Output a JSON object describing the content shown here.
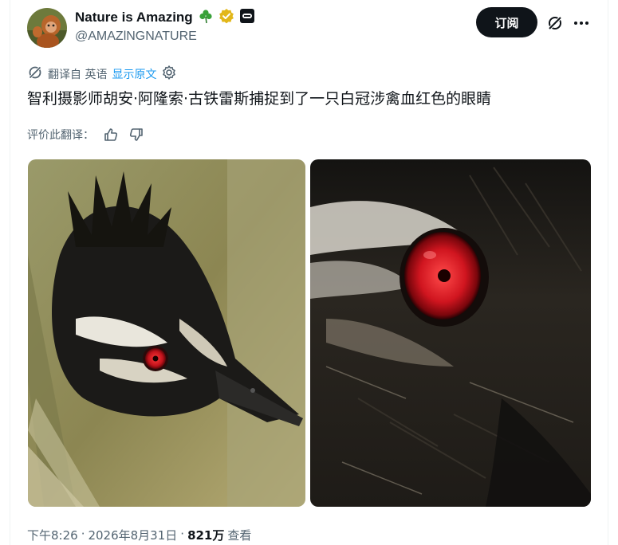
{
  "author": {
    "display_name": "Nature is Amazing",
    "emoji": "☘️",
    "handle": "@AMAZlNGNATURE"
  },
  "header": {
    "subscribe_label": "订阅"
  },
  "translation": {
    "translated_from": "翻译自 英语",
    "show_original": "显示原文"
  },
  "tweet": {
    "text": "智利摄影师胡安·阿隆索·古铁雷斯捕捉到了一只白冠涉禽血红色的眼睛"
  },
  "rating": {
    "label": "评价此翻译："
  },
  "media": [
    {
      "alt": "bird-profile-photo"
    },
    {
      "alt": "bird-eye-closeup-photo"
    }
  ],
  "meta": {
    "time": "下午8:26",
    "date": "2026年8月31日",
    "views": "821万",
    "views_label": "查看"
  },
  "colors": {
    "accent": "#1d9bf0",
    "text_primary": "#0f1419",
    "text_secondary": "#536471",
    "verified_gold": "#e2b719",
    "eye_red": "#c0121b"
  }
}
